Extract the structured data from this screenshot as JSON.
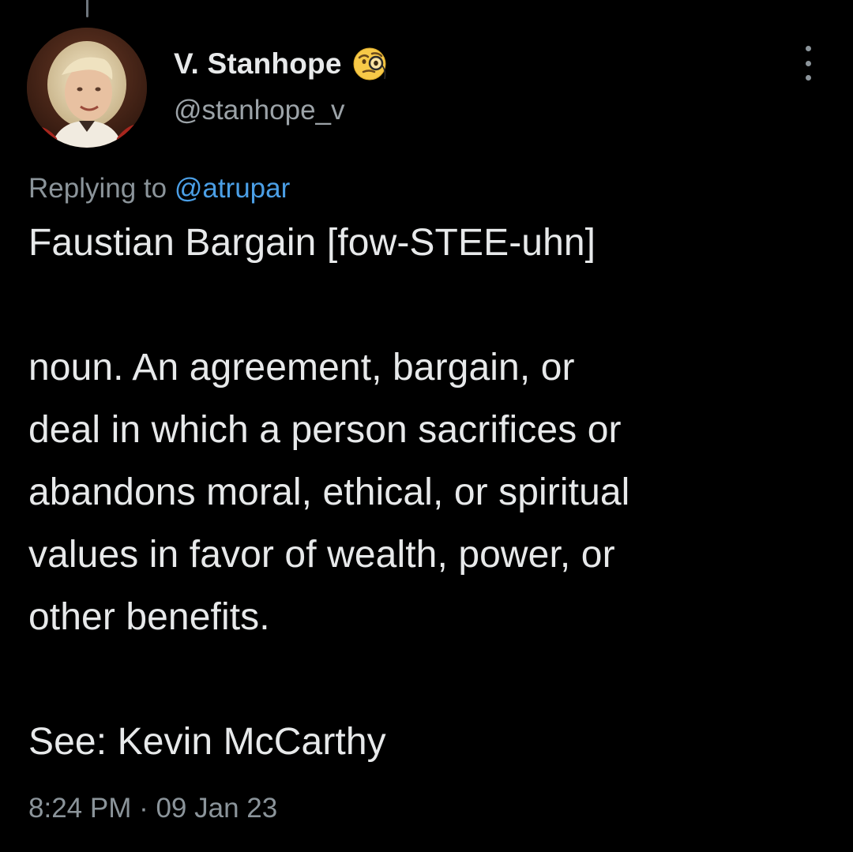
{
  "author": {
    "display_name": "V. Stanhope",
    "badge_icon": "face-with-monocle-icon",
    "handle": "@stanhope_v",
    "avatar_icon": "profile-photo"
  },
  "reply": {
    "prefix": "Replying to ",
    "mention": "@atrupar"
  },
  "tweet": {
    "paragraphs": [
      "Faustian Bargain [fow-STEE-uhn]",
      "noun. An agreement, bargain, or\ndeal in which a person sacrifices or\nabandons moral, ethical, or spiritual\nvalues in favor of wealth, power, or\nother benefits.",
      "See: Kevin McCarthy"
    ]
  },
  "meta": {
    "timestamp": "8:24 PM · 09 Jan 23"
  },
  "colors": {
    "background": "#000000",
    "text_primary": "#e7e9ea",
    "text_secondary": "#8b949a",
    "link": "#4b9fe6"
  }
}
